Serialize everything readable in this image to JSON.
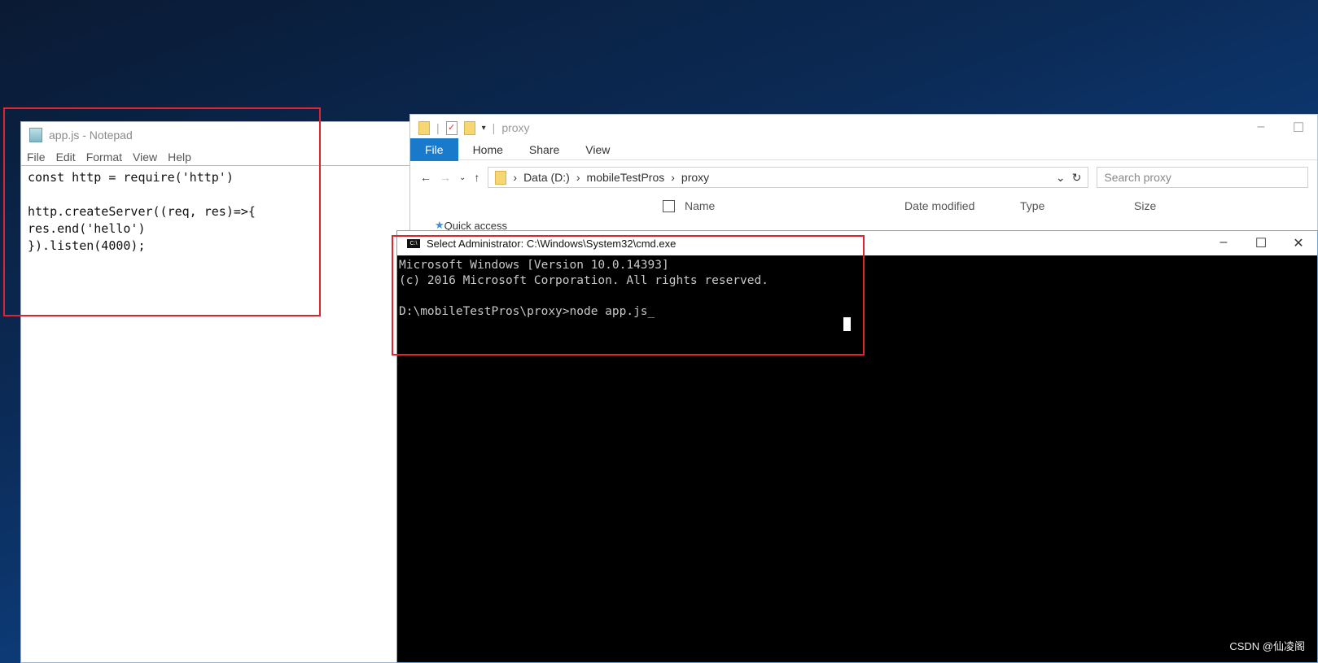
{
  "notepad": {
    "title": "app.js - Notepad",
    "menu": [
      "File",
      "Edit",
      "Format",
      "View",
      "Help"
    ],
    "content": "const http = require('http')\n\nhttp.createServer((req, res)=>{\nres.end('hello')\n}).listen(4000);"
  },
  "explorer": {
    "title": "proxy",
    "ribbon_tabs": [
      "File",
      "Home",
      "Share",
      "View"
    ],
    "breadcrumb": [
      "Data (D:)",
      "mobileTestPros",
      "proxy"
    ],
    "search_placeholder": "Search proxy",
    "columns": [
      "Name",
      "Date modified",
      "Type",
      "Size"
    ],
    "nav_item": "Quick access"
  },
  "cmd": {
    "title": "Select Administrator: C:\\Windows\\System32\\cmd.exe",
    "lines": [
      "Microsoft Windows [Version 10.0.14393]",
      "(c) 2016 Microsoft Corporation. All rights reserved.",
      "",
      "D:\\mobileTestPros\\proxy>node app.js_"
    ]
  },
  "watermark": "CSDN @仙凌阁",
  "colors": {
    "highlight": "#e0242f",
    "ribbon_file": "#1979ca"
  }
}
